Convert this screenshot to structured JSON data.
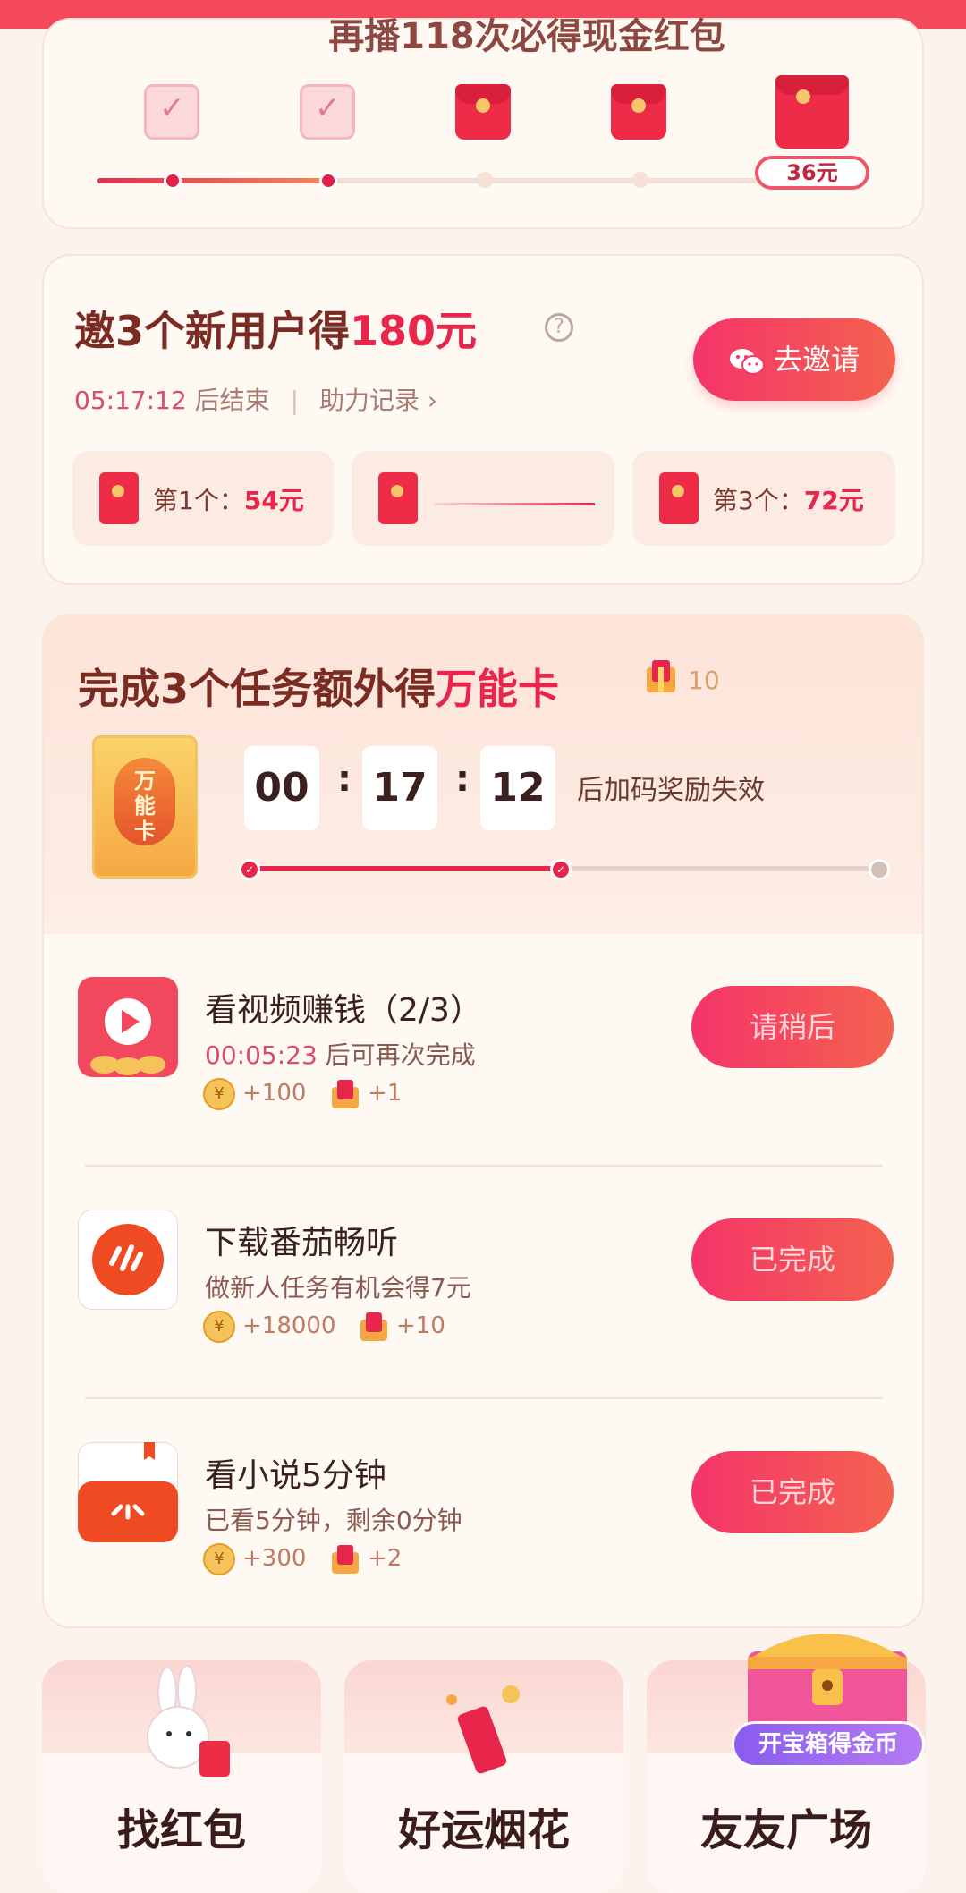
{
  "header": {
    "partial_title": "再播118次必得现金红包"
  },
  "progress_card": {
    "final_amount": "36元"
  },
  "invite": {
    "title_prefix": "邀3个新用户得",
    "title_amount": "180元",
    "help_glyph": "?",
    "countdown": "05:17:12",
    "countdown_suffix": "后结束",
    "record_link": "助力记录 ›",
    "invite_button": "去邀请",
    "slots": [
      {
        "label": "第1个：",
        "amount": "54元"
      },
      {
        "label": "",
        "amount": ""
      },
      {
        "label": "第3个：",
        "amount": "72元"
      }
    ]
  },
  "tasks_card": {
    "title_prefix": "完成3个任务额外得",
    "title_highlight": "万能卡",
    "card_count": "10",
    "card_badge": "万\n能\n卡",
    "timer": {
      "hh": "00",
      "mm": "17",
      "ss": "12",
      "sep": ":",
      "note": "后加码奖励失效"
    },
    "tasks": [
      {
        "name": "看视频赚钱（2/3）",
        "desc_time": "00:05:23",
        "desc": " 后可再次完成",
        "coin": "+100",
        "card": "+1",
        "button": "请稍后"
      },
      {
        "name": "下载番茄畅听",
        "desc_time": "",
        "desc": "做新人任务有机会得7元",
        "coin": "+18000",
        "card": "+10",
        "button": "已完成"
      },
      {
        "name": "看小说5分钟",
        "desc_time": "",
        "desc": "已看5分钟，剩余0分钟",
        "coin": "+300",
        "card": "+2",
        "button": "已完成"
      }
    ]
  },
  "bottom_tiles": [
    "找红包",
    "好运烟花",
    "友友广场"
  ],
  "treasure_chest": {
    "label": "开宝箱得金币"
  },
  "coin_glyph": "¥",
  "colors": {
    "accent": "#e8264b",
    "button_gradient_start": "#f5346a",
    "button_gradient_end": "#f4624e",
    "title": "#7a2b22"
  }
}
